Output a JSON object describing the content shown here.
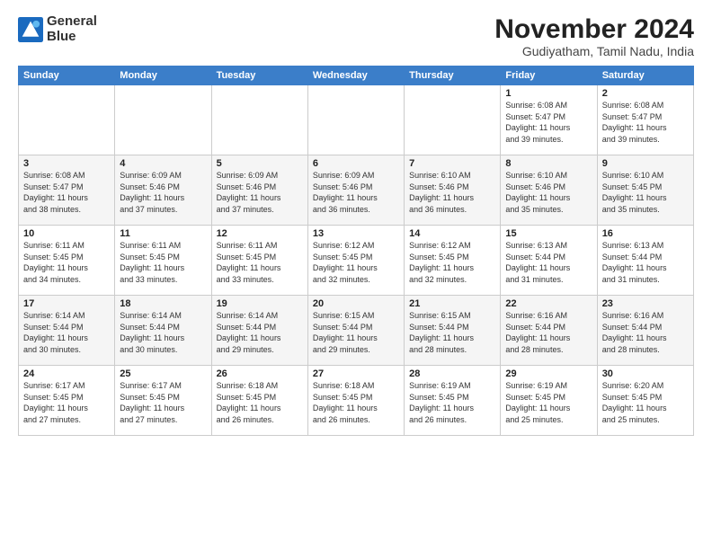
{
  "logo": {
    "line1": "General",
    "line2": "Blue"
  },
  "title": "November 2024",
  "subtitle": "Gudiyatham, Tamil Nadu, India",
  "headers": [
    "Sunday",
    "Monday",
    "Tuesday",
    "Wednesday",
    "Thursday",
    "Friday",
    "Saturday"
  ],
  "weeks": [
    [
      {
        "day": "",
        "info": ""
      },
      {
        "day": "",
        "info": ""
      },
      {
        "day": "",
        "info": ""
      },
      {
        "day": "",
        "info": ""
      },
      {
        "day": "",
        "info": ""
      },
      {
        "day": "1",
        "info": "Sunrise: 6:08 AM\nSunset: 5:47 PM\nDaylight: 11 hours\nand 39 minutes."
      },
      {
        "day": "2",
        "info": "Sunrise: 6:08 AM\nSunset: 5:47 PM\nDaylight: 11 hours\nand 39 minutes."
      }
    ],
    [
      {
        "day": "3",
        "info": "Sunrise: 6:08 AM\nSunset: 5:47 PM\nDaylight: 11 hours\nand 38 minutes."
      },
      {
        "day": "4",
        "info": "Sunrise: 6:09 AM\nSunset: 5:46 PM\nDaylight: 11 hours\nand 37 minutes."
      },
      {
        "day": "5",
        "info": "Sunrise: 6:09 AM\nSunset: 5:46 PM\nDaylight: 11 hours\nand 37 minutes."
      },
      {
        "day": "6",
        "info": "Sunrise: 6:09 AM\nSunset: 5:46 PM\nDaylight: 11 hours\nand 36 minutes."
      },
      {
        "day": "7",
        "info": "Sunrise: 6:10 AM\nSunset: 5:46 PM\nDaylight: 11 hours\nand 36 minutes."
      },
      {
        "day": "8",
        "info": "Sunrise: 6:10 AM\nSunset: 5:46 PM\nDaylight: 11 hours\nand 35 minutes."
      },
      {
        "day": "9",
        "info": "Sunrise: 6:10 AM\nSunset: 5:45 PM\nDaylight: 11 hours\nand 35 minutes."
      }
    ],
    [
      {
        "day": "10",
        "info": "Sunrise: 6:11 AM\nSunset: 5:45 PM\nDaylight: 11 hours\nand 34 minutes."
      },
      {
        "day": "11",
        "info": "Sunrise: 6:11 AM\nSunset: 5:45 PM\nDaylight: 11 hours\nand 33 minutes."
      },
      {
        "day": "12",
        "info": "Sunrise: 6:11 AM\nSunset: 5:45 PM\nDaylight: 11 hours\nand 33 minutes."
      },
      {
        "day": "13",
        "info": "Sunrise: 6:12 AM\nSunset: 5:45 PM\nDaylight: 11 hours\nand 32 minutes."
      },
      {
        "day": "14",
        "info": "Sunrise: 6:12 AM\nSunset: 5:45 PM\nDaylight: 11 hours\nand 32 minutes."
      },
      {
        "day": "15",
        "info": "Sunrise: 6:13 AM\nSunset: 5:44 PM\nDaylight: 11 hours\nand 31 minutes."
      },
      {
        "day": "16",
        "info": "Sunrise: 6:13 AM\nSunset: 5:44 PM\nDaylight: 11 hours\nand 31 minutes."
      }
    ],
    [
      {
        "day": "17",
        "info": "Sunrise: 6:14 AM\nSunset: 5:44 PM\nDaylight: 11 hours\nand 30 minutes."
      },
      {
        "day": "18",
        "info": "Sunrise: 6:14 AM\nSunset: 5:44 PM\nDaylight: 11 hours\nand 30 minutes."
      },
      {
        "day": "19",
        "info": "Sunrise: 6:14 AM\nSunset: 5:44 PM\nDaylight: 11 hours\nand 29 minutes."
      },
      {
        "day": "20",
        "info": "Sunrise: 6:15 AM\nSunset: 5:44 PM\nDaylight: 11 hours\nand 29 minutes."
      },
      {
        "day": "21",
        "info": "Sunrise: 6:15 AM\nSunset: 5:44 PM\nDaylight: 11 hours\nand 28 minutes."
      },
      {
        "day": "22",
        "info": "Sunrise: 6:16 AM\nSunset: 5:44 PM\nDaylight: 11 hours\nand 28 minutes."
      },
      {
        "day": "23",
        "info": "Sunrise: 6:16 AM\nSunset: 5:44 PM\nDaylight: 11 hours\nand 28 minutes."
      }
    ],
    [
      {
        "day": "24",
        "info": "Sunrise: 6:17 AM\nSunset: 5:45 PM\nDaylight: 11 hours\nand 27 minutes."
      },
      {
        "day": "25",
        "info": "Sunrise: 6:17 AM\nSunset: 5:45 PM\nDaylight: 11 hours\nand 27 minutes."
      },
      {
        "day": "26",
        "info": "Sunrise: 6:18 AM\nSunset: 5:45 PM\nDaylight: 11 hours\nand 26 minutes."
      },
      {
        "day": "27",
        "info": "Sunrise: 6:18 AM\nSunset: 5:45 PM\nDaylight: 11 hours\nand 26 minutes."
      },
      {
        "day": "28",
        "info": "Sunrise: 6:19 AM\nSunset: 5:45 PM\nDaylight: 11 hours\nand 26 minutes."
      },
      {
        "day": "29",
        "info": "Sunrise: 6:19 AM\nSunset: 5:45 PM\nDaylight: 11 hours\nand 25 minutes."
      },
      {
        "day": "30",
        "info": "Sunrise: 6:20 AM\nSunset: 5:45 PM\nDaylight: 11 hours\nand 25 minutes."
      }
    ]
  ]
}
